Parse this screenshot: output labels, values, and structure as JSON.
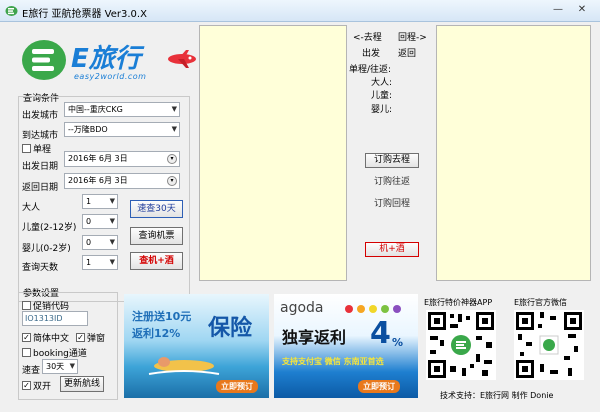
{
  "window": {
    "title": "E旅行 亚航抢票器 Ver3.0.X",
    "minimize": "—",
    "close": "✕"
  },
  "logo": {
    "text": "E旅行",
    "sub": "easy2world.com"
  },
  "query": {
    "group_label": "查询条件",
    "from_label": "出发城市",
    "from_value": "中国--重庆CKG",
    "to_label": "到达城市",
    "to_value": "--万隆BDO",
    "oneway_label": "单程",
    "depart_label": "出发日期",
    "depart_value": "2016年 6月 3日",
    "return_label": "返回日期",
    "return_value": "2016年 6月 3日",
    "adult_label": "大人",
    "adult_value": "1",
    "child_label": "儿童(2-12岁)",
    "child_value": "0",
    "infant_label": "婴儿(0-2岁)",
    "infant_value": "0",
    "days_label": "查询天数",
    "days_value": "1",
    "btn_quick30": "速查30天",
    "btn_query": "查询机票",
    "btn_hotel": "查机+酒"
  },
  "params": {
    "group_label": "参数设置",
    "promo_label": "促销代码",
    "promo_value": "IO1313ID",
    "simplified_label": "简体中文",
    "popup_label": "弹窗",
    "booking_label": "booking通道",
    "speed_label": "速查",
    "speed_value": "30天",
    "roundtrip_label": "双开",
    "update_btn": "更新航线"
  },
  "middle": {
    "go_label": "<-去程",
    "back_label": "回程->",
    "depart_label": "出发",
    "return_label": "返回",
    "type_label": "单程/往返:",
    "adult_label": "大人:",
    "child_label": "儿童:",
    "infant_label": "婴儿:",
    "btn_book_go": "订购去程",
    "btn_book_round": "订购往返",
    "btn_book_back": "订购回程",
    "btn_plus_hotel": "机+酒"
  },
  "ads": {
    "ad1_line1": "注册送10元",
    "ad1_line2": "返利12%",
    "ad1_big": "保险",
    "ad1_button": "立即预订",
    "ad2_brand": "agoda",
    "ad2_title": "独享返利",
    "ad2_percent": "4",
    "ad2_unit": "%",
    "ad2_sub": "支持支付宝 微信 东南亚首选",
    "ad2_button": "立即预订"
  },
  "qr": {
    "app_label": "E旅行特价神器APP",
    "wechat_label": "E旅行官方微信",
    "footer": "技术支持：E旅行网  制作 Donie"
  },
  "colors": {
    "accent": "#1a7ed6",
    "panel": "#ffffd9",
    "red": "#d40000"
  }
}
